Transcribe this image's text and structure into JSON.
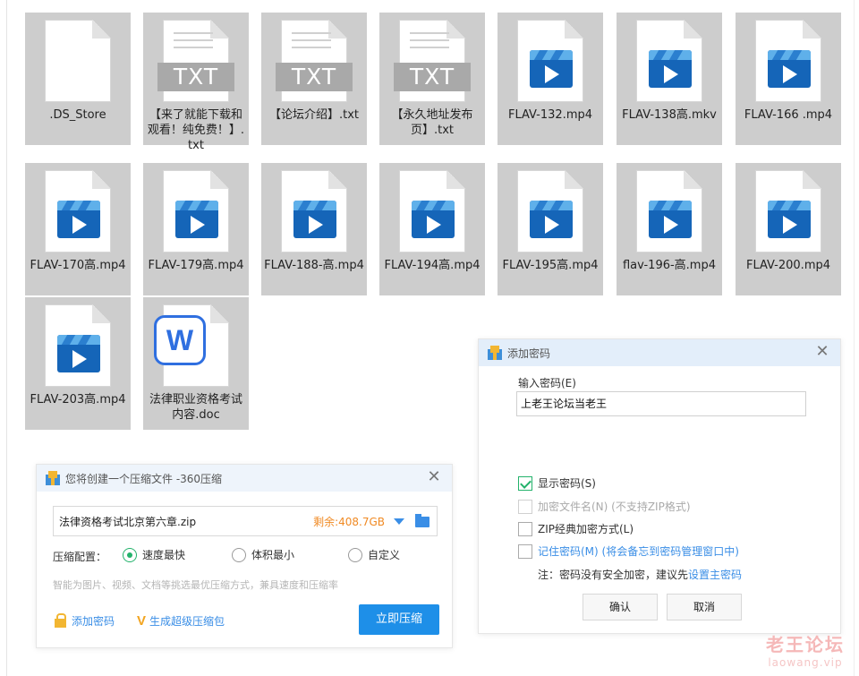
{
  "files": [
    {
      "name": ".DS_Store",
      "type": "blank"
    },
    {
      "name": "【来了就能下载和观看！纯免费！】.txt",
      "type": "txt",
      "badge": "TXT"
    },
    {
      "name": "【论坛介绍】.txt",
      "type": "txt",
      "badge": "TXT"
    },
    {
      "name": "【永久地址发布页】.txt",
      "type": "txt",
      "badge": "TXT"
    },
    {
      "name": "FLAV-132.mp4",
      "type": "video"
    },
    {
      "name": "FLAV-138高.mkv",
      "type": "video"
    },
    {
      "name": "FLAV-166 .mp4",
      "type": "video"
    },
    {
      "name": "FLAV-170高.mp4",
      "type": "video"
    },
    {
      "name": "FLAV-179高.mp4",
      "type": "video"
    },
    {
      "name": "FLAV-188-高.mp4",
      "type": "video"
    },
    {
      "name": "FLAV-194高.mp4",
      "type": "video"
    },
    {
      "name": "FLAV-195高.mp4",
      "type": "video"
    },
    {
      "name": "flav-196-高.mp4",
      "type": "video"
    },
    {
      "name": "FLAV-200.mp4",
      "type": "video"
    },
    {
      "name": "FLAV-203高.mp4",
      "type": "video"
    },
    {
      "name": "法律职业资格考试内容.doc",
      "type": "word",
      "badge": "W"
    }
  ],
  "compress_dialog": {
    "title": "您将创建一个压缩文件 -360压缩",
    "file_path": "法律资格考试北京第六章.zip",
    "remaining": "剩余:408.7GB",
    "config_label": "压缩配置：",
    "options": [
      {
        "label": "速度最快",
        "selected": true
      },
      {
        "label": "体积最小",
        "selected": false
      },
      {
        "label": "自定义",
        "selected": false
      }
    ],
    "hint": "智能为图片、视频、文档等挑选最优压缩方式，兼具速度和压缩率",
    "add_password_label": "添加密码",
    "super_package_label": "生成超级压缩包",
    "compress_button": "立即压缩",
    "close": "✕"
  },
  "password_dialog": {
    "title": "添加密码",
    "input_label": "输入密码(E)",
    "password_value": "上老王论坛当老王",
    "checkboxes": [
      {
        "label": "显示密码(S)",
        "checked": true,
        "state": "normal"
      },
      {
        "label": "加密文件名(N) (不支持ZIP格式)",
        "checked": false,
        "state": "disabled"
      },
      {
        "label": "ZIP经典加密方式(L)",
        "checked": false,
        "state": "normal"
      },
      {
        "label": "记住密码(M) (将会备忘到密码管理窗口中)",
        "checked": false,
        "state": "link"
      }
    ],
    "note_prefix": "注：密码没有安全加密，建议先",
    "note_link": "设置主密码",
    "ok_button": "确认",
    "cancel_button": "取消",
    "close": "✕"
  },
  "watermark": {
    "line1": "老王论坛",
    "line2": "laowang.vip"
  },
  "colors": {
    "accent": "#1e8fe8",
    "tile_bg": "#cdcdcd",
    "video_blue": "#1565b8",
    "check_green": "#23b26b",
    "warn_orange": "#f08a24"
  }
}
